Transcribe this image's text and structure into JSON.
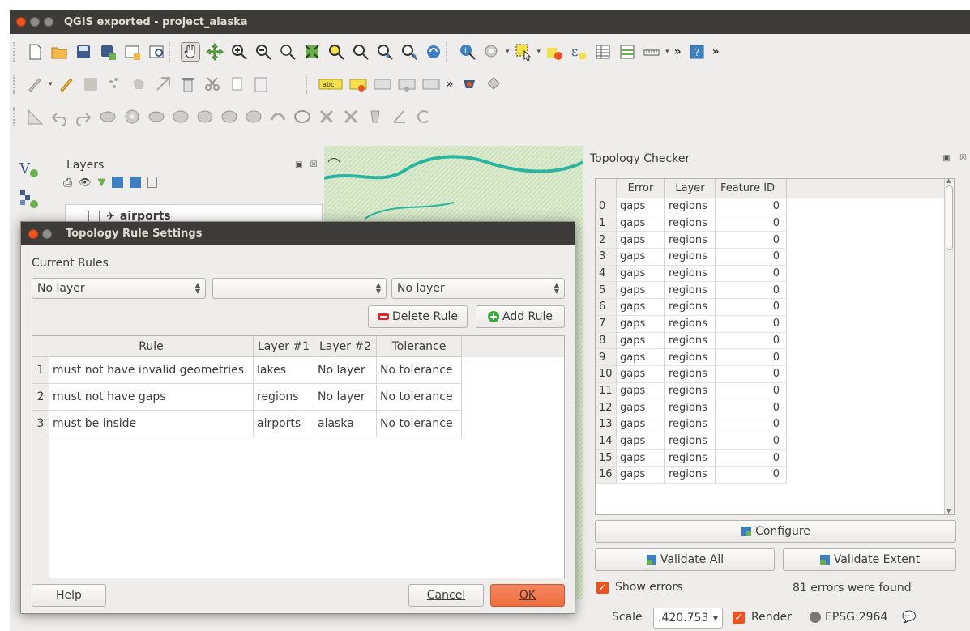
{
  "window": {
    "title": "QGIS exported - project_alaska"
  },
  "layers_panel": {
    "title": "Layers",
    "layer_item": "airports"
  },
  "topology_checker": {
    "title": "Topology Checker",
    "columns": [
      "Error",
      "Layer",
      "Feature ID"
    ],
    "rows": [
      {
        "idx": "0",
        "error": "gaps",
        "layer": "regions",
        "fid": "0"
      },
      {
        "idx": "1",
        "error": "gaps",
        "layer": "regions",
        "fid": "0"
      },
      {
        "idx": "2",
        "error": "gaps",
        "layer": "regions",
        "fid": "0"
      },
      {
        "idx": "3",
        "error": "gaps",
        "layer": "regions",
        "fid": "0"
      },
      {
        "idx": "4",
        "error": "gaps",
        "layer": "regions",
        "fid": "0"
      },
      {
        "idx": "5",
        "error": "gaps",
        "layer": "regions",
        "fid": "0"
      },
      {
        "idx": "6",
        "error": "gaps",
        "layer": "regions",
        "fid": "0"
      },
      {
        "idx": "7",
        "error": "gaps",
        "layer": "regions",
        "fid": "0"
      },
      {
        "idx": "8",
        "error": "gaps",
        "layer": "regions",
        "fid": "0"
      },
      {
        "idx": "9",
        "error": "gaps",
        "layer": "regions",
        "fid": "0"
      },
      {
        "idx": "10",
        "error": "gaps",
        "layer": "regions",
        "fid": "0"
      },
      {
        "idx": "11",
        "error": "gaps",
        "layer": "regions",
        "fid": "0"
      },
      {
        "idx": "12",
        "error": "gaps",
        "layer": "regions",
        "fid": "0"
      },
      {
        "idx": "13",
        "error": "gaps",
        "layer": "regions",
        "fid": "0"
      },
      {
        "idx": "14",
        "error": "gaps",
        "layer": "regions",
        "fid": "0"
      },
      {
        "idx": "15",
        "error": "gaps",
        "layer": "regions",
        "fid": "0"
      },
      {
        "idx": "16",
        "error": "gaps",
        "layer": "regions",
        "fid": "0"
      }
    ],
    "configure_label": "Configure",
    "validate_all_label": "Validate All",
    "validate_extent_label": "Validate Extent",
    "show_errors_label": "Show errors",
    "status_text": "81 errors were found"
  },
  "statusbar": {
    "scale_label": "Scale",
    "scale_value": ".420.753",
    "render_label": "Render",
    "crs_label": "EPSG:2964"
  },
  "dialog": {
    "title": "Topology Rule Settings",
    "current_rules_label": "Current Rules",
    "combo1_value": "No layer",
    "combo2_value": "",
    "combo3_value": "No layer",
    "delete_rule_label": "Delete Rule",
    "add_rule_label": "Add Rule",
    "columns": [
      "Rule",
      "Layer #1",
      "Layer #2",
      "Tolerance"
    ],
    "rules": [
      {
        "idx": "1",
        "rule": "must not have invalid geometries",
        "layer1": "lakes",
        "layer2": "No layer",
        "tolerance": "No tolerance"
      },
      {
        "idx": "2",
        "rule": "must not have gaps",
        "layer1": "regions",
        "layer2": "No layer",
        "tolerance": "No tolerance"
      },
      {
        "idx": "3",
        "rule": "must be inside",
        "layer1": "airports",
        "layer2": "alaska",
        "tolerance": "No tolerance"
      }
    ],
    "help_label": "Help",
    "cancel_label": "Cancel",
    "ok_label": "OK"
  },
  "colors": {
    "accent": "#e95420",
    "titlebar": "#3c3b37",
    "window_bg": "#efedec"
  }
}
